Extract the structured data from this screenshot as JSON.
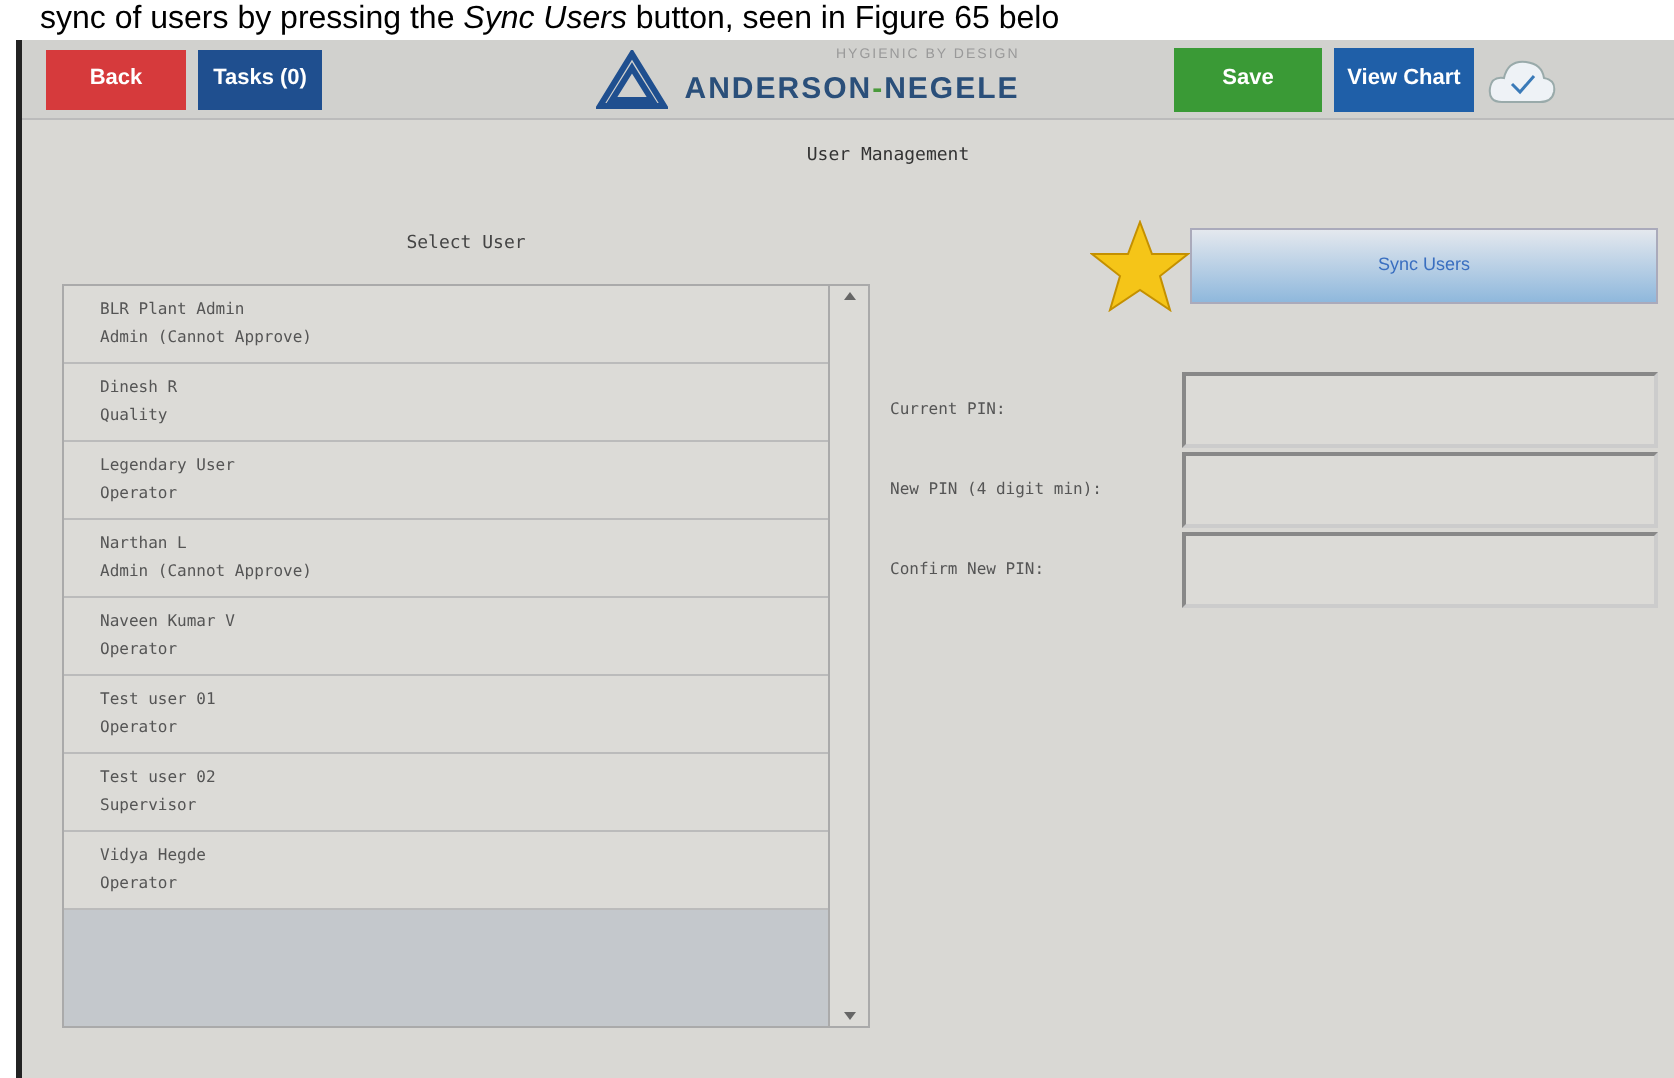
{
  "caption": "sync of users by pressing the *Sync Users* button, seen in Figure 65 belo",
  "header": {
    "back": "Back",
    "tasks": "Tasks (0)",
    "tagline": "HYGIENIC BY DESIGN",
    "brand_left": "ANDERSON",
    "brand_sep": "-",
    "brand_right": "NEGELE",
    "save": "Save",
    "view_chart": "View Chart"
  },
  "title": "User Management",
  "user_list": {
    "label": "Select User",
    "users": [
      {
        "name": "BLR Plant Admin",
        "role": "Admin (Cannot Approve)"
      },
      {
        "name": "Dinesh R",
        "role": "Quality"
      },
      {
        "name": "Legendary User",
        "role": "Operator"
      },
      {
        "name": "Narthan L",
        "role": "Admin (Cannot Approve)"
      },
      {
        "name": "Naveen Kumar V",
        "role": "Operator"
      },
      {
        "name": "Test user 01",
        "role": "Operator"
      },
      {
        "name": "Test user 02",
        "role": "Supervisor"
      },
      {
        "name": "Vidya Hegde",
        "role": "Operator"
      }
    ]
  },
  "sync_button": "Sync Users",
  "pin_fields": [
    {
      "label": "Current PIN:"
    },
    {
      "label": "New PIN (4 digit min):"
    },
    {
      "label": "Confirm New PIN:"
    }
  ]
}
